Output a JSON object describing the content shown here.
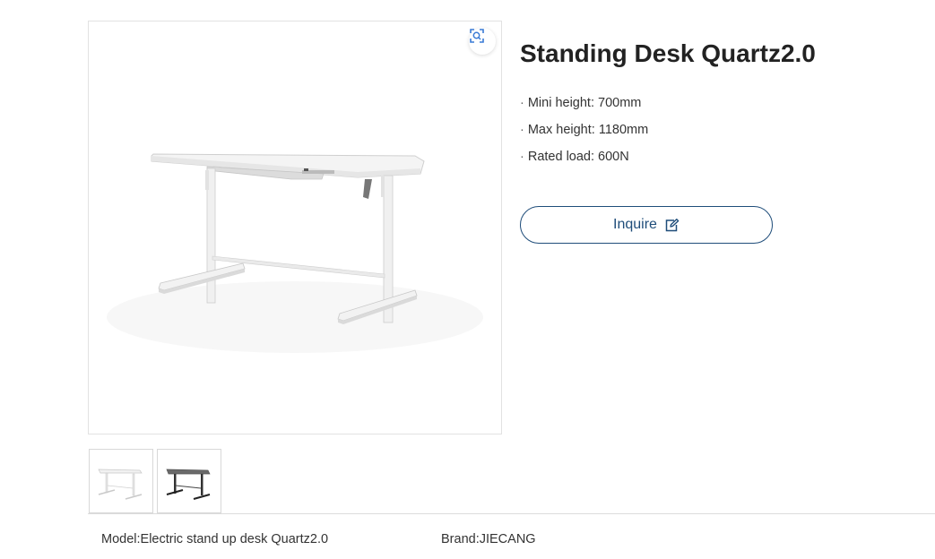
{
  "product": {
    "title": "Standing Desk Quartz2.0",
    "specs": [
      "Mini height: 700mm",
      "Max height: 1180mm",
      "Rated load: 600N"
    ],
    "inquire_label": "Inquire"
  },
  "gallery": {
    "zoom_icon": "scan-zoom-icon",
    "thumbnails": [
      {
        "name": "white-desk-thumbnail"
      },
      {
        "name": "dark-desk-thumbnail"
      }
    ]
  },
  "details": {
    "model": "Model:Electric stand up desk Quartz2.0",
    "brand": "Brand:JIECANG"
  },
  "colors": {
    "accent": "#1f4d7a",
    "zoom_icon": "#3a7bd5"
  }
}
